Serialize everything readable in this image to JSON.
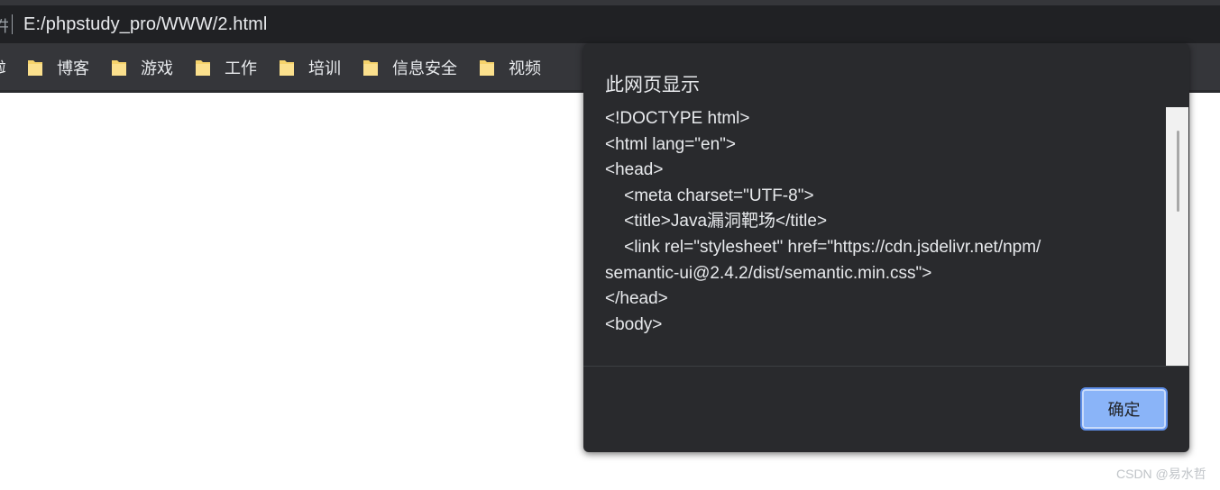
{
  "address_bar": {
    "prefix": "牛",
    "url": "E:/phpstudy_pro/WWW/2.html"
  },
  "bookmarks": {
    "cut_label": "站",
    "items": [
      {
        "label": "博客"
      },
      {
        "label": "游戏"
      },
      {
        "label": "工作"
      },
      {
        "label": "培训"
      },
      {
        "label": "信息安全"
      },
      {
        "label": "视频"
      }
    ]
  },
  "dialog": {
    "title": "此网页显示",
    "message": "<!DOCTYPE html>\n<html lang=\"en\">\n<head>\n    <meta charset=\"UTF-8\">\n    <title>Java漏洞靶场</title>\n    <link rel=\"stylesheet\" href=\"https://cdn.jsdelivr.net/npm/\nsemantic-ui@2.4.2/dist/semantic.min.css\">\n</head>\n<body>",
    "ok_label": "确定"
  },
  "watermark": "CSDN @易水哲",
  "colors": {
    "folder": "#f6d36b",
    "button": "#8ab4f8",
    "dialog_bg": "#292a2d"
  }
}
